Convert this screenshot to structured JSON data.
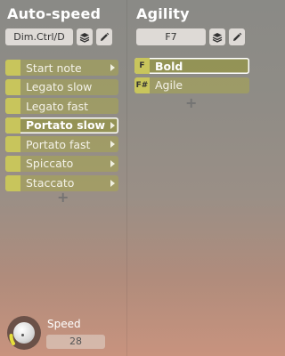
{
  "left": {
    "title": "Auto-speed",
    "field_value": "Dim.Ctrl/D",
    "items": [
      {
        "label": "Start note"
      },
      {
        "label": "Legato slow"
      },
      {
        "label": "Legato fast"
      },
      {
        "label": "Portato slow",
        "selected": true
      },
      {
        "label": "Portato fast"
      },
      {
        "label": "Spiccato"
      },
      {
        "label": "Staccato"
      }
    ],
    "add_symbol": "+"
  },
  "right": {
    "title": "Agility",
    "field_value": "F7",
    "items": [
      {
        "key": "F",
        "label": "Bold",
        "selected": true
      },
      {
        "key": "F#",
        "label": "Agile"
      }
    ],
    "add_symbol": "+"
  },
  "speed": {
    "label": "Speed",
    "value": "28",
    "level_fraction": 0.22
  },
  "colors": {
    "item_bg": "#aaa84e",
    "swatch": "#c8c55c",
    "knob_ring": "#6b5148",
    "knob_arc": "#e6de3c"
  },
  "icons": [
    "layers-icon",
    "pencil-icon",
    "chevron-right-icon",
    "plus-icon"
  ]
}
